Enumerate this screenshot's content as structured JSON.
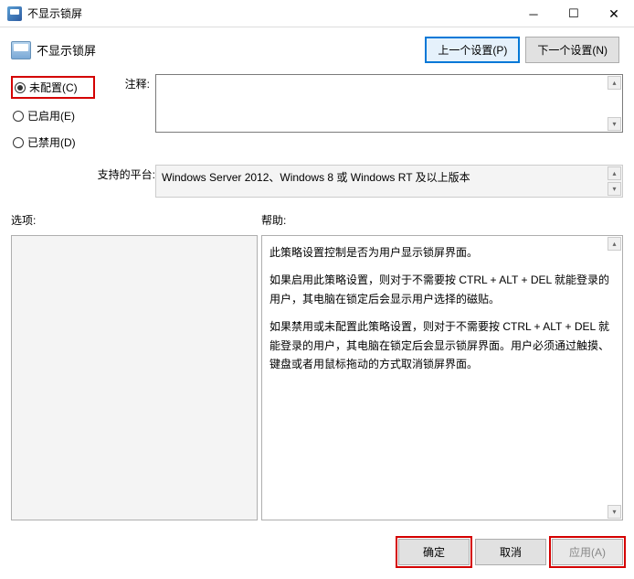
{
  "titlebar": {
    "title": "不显示锁屏"
  },
  "header": {
    "title": "不显示锁屏",
    "prev_button": "上一个设置(P)",
    "next_button": "下一个设置(N)"
  },
  "radios": {
    "not_configured": "未配置(C)",
    "enabled": "已启用(E)",
    "disabled": "已禁用(D)"
  },
  "labels": {
    "comment": "注释:",
    "platform": "支持的平台:",
    "options": "选项:",
    "help": "帮助:"
  },
  "platform_text": "Windows Server 2012、Windows 8 或 Windows RT 及以上版本",
  "help": {
    "p1": "此策略设置控制是否为用户显示锁屏界面。",
    "p2": "如果启用此策略设置，则对于不需要按 CTRL + ALT + DEL 就能登录的用户，其电脑在锁定后会显示用户选择的磁贴。",
    "p3": "如果禁用或未配置此策略设置，则对于不需要按 CTRL + ALT + DEL 就能登录的用户，其电脑在锁定后会显示锁屏界面。用户必须通过触摸、键盘或者用鼠标拖动的方式取消锁屏界面。"
  },
  "footer": {
    "ok": "确定",
    "cancel": "取消",
    "apply": "应用(A)"
  }
}
